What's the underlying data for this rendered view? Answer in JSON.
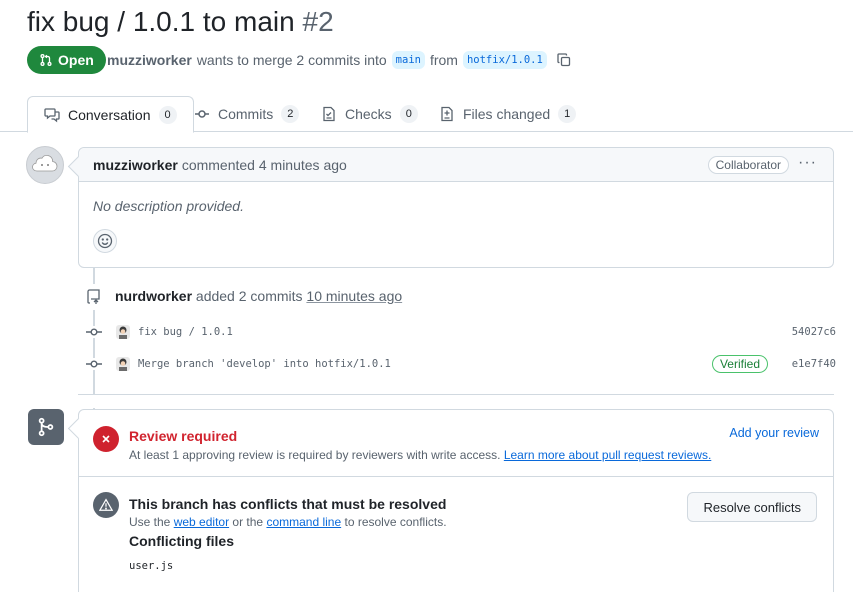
{
  "pr": {
    "title": "fix bug / 1.0.1 to main",
    "number": "#2",
    "state": "Open",
    "author": "muzziworker",
    "summary": "wants to merge 2 commits into",
    "base_branch": "main",
    "from_word": "from",
    "head_branch": "hotfix/1.0.1"
  },
  "tabs": [
    {
      "label": "Conversation",
      "count": "0",
      "icon": "comment-discussion-icon"
    },
    {
      "label": "Commits",
      "count": "2",
      "icon": "git-commit-icon"
    },
    {
      "label": "Checks",
      "count": "0",
      "icon": "checklist-icon"
    },
    {
      "label": "Files changed",
      "count": "1",
      "icon": "file-diff-icon"
    }
  ],
  "comment": {
    "author": "muzziworker",
    "action": "commented",
    "time": "4 minutes ago",
    "role": "Collaborator",
    "menu": "···",
    "body": "No description provided."
  },
  "commit_event": {
    "author": "nurdworker",
    "action": "added 2 commits",
    "time": "10 minutes ago",
    "commits": [
      {
        "message": "fix bug / 1.0.1",
        "sha": "54027c6",
        "verified": ""
      },
      {
        "message": "Merge branch 'develop' into hotfix/1.0.1",
        "sha": "e1e7f40",
        "verified": "Verified"
      }
    ]
  },
  "merge_box": {
    "review_title": "Review required",
    "review_desc": "At least 1 approving review is required by reviewers with write access.",
    "review_link": "Learn more about pull request reviews.",
    "add_review": "Add your review",
    "conflict_title": "This branch has conflicts that must be resolved",
    "conflict_desc_1": "Use the",
    "conflict_link_1": "web editor",
    "conflict_desc_2": "or the",
    "conflict_link_2": "command line",
    "conflict_desc_3": "to resolve conflicts.",
    "resolve_button": "Resolve conflicts",
    "conflicting_files_title": "Conflicting files",
    "files": [
      "user.js"
    ]
  },
  "colors": {
    "open_green": "#1f883d",
    "danger_red": "#cf222e",
    "link_blue": "#0969da"
  }
}
